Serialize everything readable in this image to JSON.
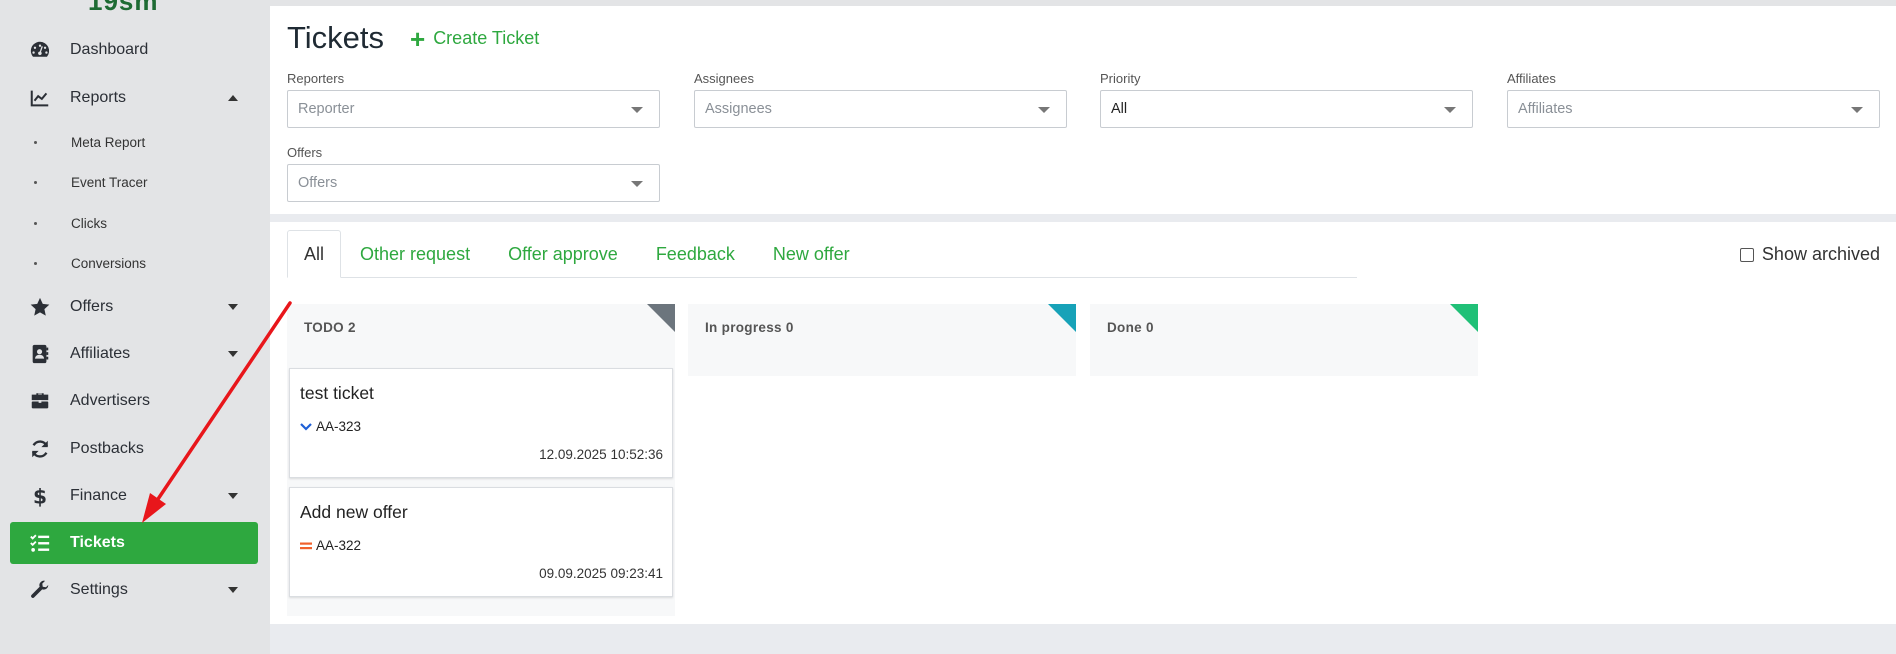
{
  "app": {
    "logo_text": "19sm",
    "brand_color": "#2ea83f"
  },
  "sidebar": {
    "items": [
      {
        "label": "Dashboard",
        "icon": "dashboard-icon"
      },
      {
        "label": "Reports",
        "icon": "chart-line-icon",
        "expanded": true,
        "subitems": [
          "Meta Report",
          "Event Tracer",
          "Clicks",
          "Conversions"
        ]
      },
      {
        "label": "Offers",
        "icon": "star-icon"
      },
      {
        "label": "Affiliates",
        "icon": "address-book-icon"
      },
      {
        "label": "Advertisers",
        "icon": "briefcase-icon"
      },
      {
        "label": "Postbacks",
        "icon": "refresh-icon"
      },
      {
        "label": "Finance",
        "icon": "dollar-icon"
      },
      {
        "label": "Tickets",
        "icon": "tasks-icon",
        "active": true
      },
      {
        "label": "Settings",
        "icon": "wrench-icon"
      }
    ]
  },
  "header": {
    "title": "Tickets",
    "create_label": "Create Ticket"
  },
  "filters": {
    "reporters": {
      "label": "Reporters",
      "placeholder": "Reporter"
    },
    "assignees": {
      "label": "Assignees",
      "placeholder": "Assignees"
    },
    "priority": {
      "label": "Priority",
      "value": "All"
    },
    "affiliates": {
      "label": "Affiliates",
      "placeholder": "Affiliates"
    },
    "offers": {
      "label": "Offers",
      "placeholder": "Offers"
    }
  },
  "tabs": [
    "All",
    "Other request",
    "Offer approve",
    "Feedback",
    "New offer"
  ],
  "active_tab": "All",
  "show_archived": {
    "label": "Show archived",
    "checked": false
  },
  "columns": [
    {
      "title": "TODO 2",
      "color": "#6c757d"
    },
    {
      "title": "In progress 0",
      "color": "#17a2b8"
    },
    {
      "title": "Done 0",
      "color": "#20c077"
    }
  ],
  "cards": [
    {
      "title": "test ticket",
      "key": "AA-323",
      "priority": "low",
      "date": "12.09.2025 10:52:36"
    },
    {
      "title": "Add new offer",
      "key": "AA-322",
      "priority": "medium",
      "date": "09.09.2025 09:23:41"
    }
  ],
  "annotation": {
    "color": "#e8161b"
  }
}
